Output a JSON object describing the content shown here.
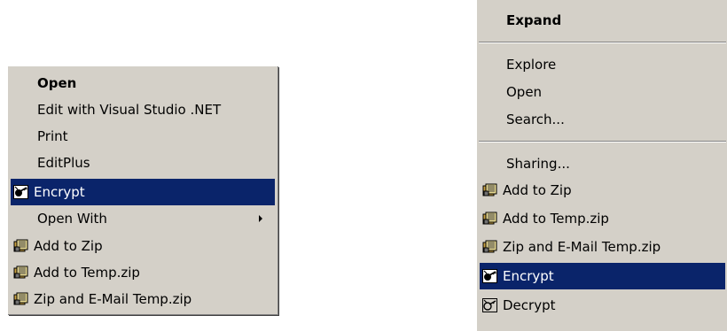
{
  "left_menu": {
    "items": [
      {
        "label": "Open",
        "bold": true
      },
      {
        "label": "Edit with Visual Studio .NET"
      },
      {
        "label": "Print"
      },
      {
        "label": "EditPlus"
      },
      {
        "label": "Encrypt",
        "icon": "encrypt-icon",
        "selected": true
      },
      {
        "label": "Open With",
        "submenu": true
      },
      {
        "label": "Add to Zip",
        "icon": "winzip-icon"
      },
      {
        "label": "Add to Temp.zip",
        "icon": "winzip-icon"
      },
      {
        "label": "Zip and E-Mail Temp.zip",
        "icon": "winzip-icon"
      }
    ]
  },
  "right_menu": {
    "items": [
      {
        "label": "Expand",
        "bold": true
      },
      {
        "label": "Explore"
      },
      {
        "label": "Open"
      },
      {
        "label": "Search..."
      },
      {
        "label": "Sharing..."
      },
      {
        "label": "Add to Zip",
        "icon": "winzip-icon"
      },
      {
        "label": "Add to Temp.zip",
        "icon": "winzip-icon"
      },
      {
        "label": "Zip and E-Mail Temp.zip",
        "icon": "winzip-icon"
      },
      {
        "label": "Encrypt",
        "icon": "encrypt-icon",
        "selected": true
      },
      {
        "label": "Decrypt",
        "icon": "decrypt-icon"
      }
    ]
  },
  "colors": {
    "menu_bg": "#d4d0c8",
    "highlight": "#0a246a",
    "highlight_text": "#ffffff"
  }
}
